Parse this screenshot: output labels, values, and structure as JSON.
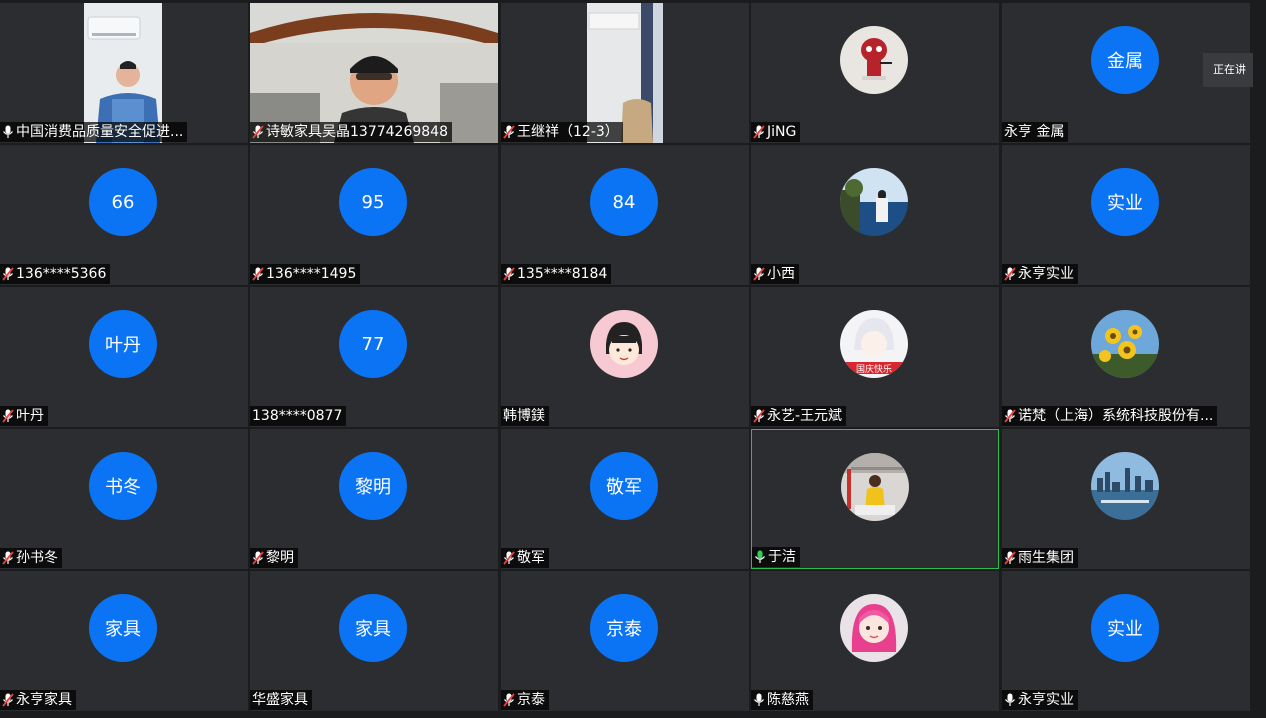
{
  "speaking_label": "正在讲",
  "tiles": [
    {
      "name": "中国消费品质量安全促进...",
      "mic": "on",
      "kind": "video",
      "video": "office"
    },
    {
      "name": "诗敏家具吴晶13774269848",
      "mic": "muted",
      "kind": "video",
      "video": "car"
    },
    {
      "name": "王继祥（12-3）",
      "mic": "muted",
      "kind": "video",
      "video": "room"
    },
    {
      "name": "JiNG",
      "mic": "muted",
      "kind": "photo",
      "photo": "toy-figure"
    },
    {
      "name": "永亨 金属",
      "mic": "none",
      "kind": "initials",
      "initials": "金属"
    },
    {
      "name": "136****5366",
      "mic": "muted",
      "kind": "initials",
      "initials": "66"
    },
    {
      "name": "136****1495",
      "mic": "muted",
      "kind": "initials",
      "initials": "95"
    },
    {
      "name": "135****8184",
      "mic": "muted",
      "kind": "initials",
      "initials": "84"
    },
    {
      "name": "小西",
      "mic": "muted",
      "kind": "photo",
      "photo": "seaside-girl"
    },
    {
      "name": "永亨实业",
      "mic": "muted",
      "kind": "initials",
      "initials": "实业"
    },
    {
      "name": "叶丹",
      "mic": "muted",
      "kind": "initials",
      "initials": "叶丹"
    },
    {
      "name": "138****0877",
      "mic": "none",
      "kind": "initials",
      "initials": "77"
    },
    {
      "name": "韩博鎂",
      "mic": "none",
      "kind": "photo",
      "photo": "cartoon-girl"
    },
    {
      "name": "永艺-王元斌",
      "mic": "muted",
      "kind": "photo",
      "photo": "anime-boy",
      "photo_caption": "国庆快乐"
    },
    {
      "name": "诺梵（上海）系统科技股份有...",
      "mic": "muted",
      "kind": "photo",
      "photo": "flowers"
    },
    {
      "name": "孙书冬",
      "mic": "muted",
      "kind": "initials",
      "initials": "书冬"
    },
    {
      "name": "黎明",
      "mic": "muted",
      "kind": "initials",
      "initials": "黎明"
    },
    {
      "name": "敬军",
      "mic": "muted",
      "kind": "initials",
      "initials": "敬军"
    },
    {
      "name": "于洁",
      "mic": "active",
      "kind": "photo",
      "photo": "woman-yellow",
      "active": true
    },
    {
      "name": "雨生集团",
      "mic": "muted",
      "kind": "photo",
      "photo": "city-skyline"
    },
    {
      "name": "永亨家具",
      "mic": "muted",
      "kind": "initials",
      "initials": "家具"
    },
    {
      "name": "华盛家具",
      "mic": "none",
      "kind": "initials",
      "initials": "家具"
    },
    {
      "name": "京泰",
      "mic": "muted",
      "kind": "initials",
      "initials": "京泰"
    },
    {
      "name": "陈慈燕",
      "mic": "on",
      "kind": "photo",
      "photo": "pink-hair-girl"
    },
    {
      "name": "永亨实业",
      "mic": "on",
      "kind": "initials",
      "initials": "实业"
    }
  ],
  "colors": {
    "avatar_blue": "#0a74f5",
    "tile_bg": "#2b2d31",
    "active_border": "#2fbd4f"
  }
}
